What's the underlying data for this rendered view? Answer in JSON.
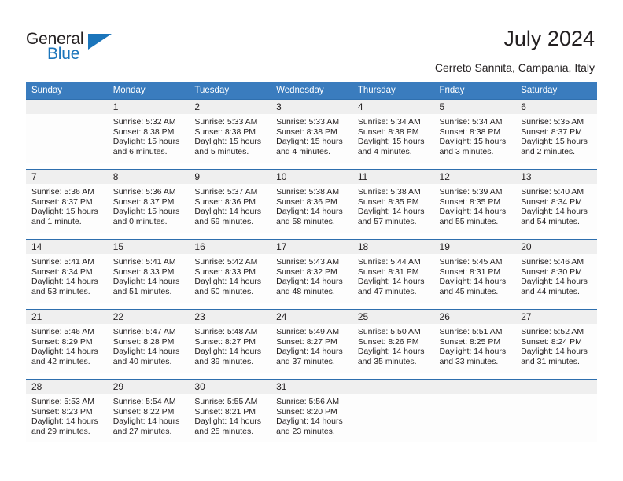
{
  "brand": {
    "name_part1": "General",
    "name_part2": "Blue",
    "triangle_icon": "triangle-icon",
    "colors": {
      "dark": "#231f20",
      "blue": "#1b75bb"
    }
  },
  "header": {
    "title": "July 2024",
    "subtitle": "Cerreto Sannita, Campania, Italy"
  },
  "calendar": {
    "header_bg": "#3a7cbe",
    "row_rule_color": "#2f6fae",
    "daynum_band_bg": "#efefef",
    "weekday_headers": [
      "Sunday",
      "Monday",
      "Tuesday",
      "Wednesday",
      "Thursday",
      "Friday",
      "Saturday"
    ],
    "weeks": [
      [
        {
          "day": "",
          "empty": true,
          "sunrise": "",
          "sunset": "",
          "daylight": ""
        },
        {
          "day": "1",
          "sunrise": "Sunrise: 5:32 AM",
          "sunset": "Sunset: 8:38 PM",
          "daylight": "Daylight: 15 hours and 6 minutes."
        },
        {
          "day": "2",
          "sunrise": "Sunrise: 5:33 AM",
          "sunset": "Sunset: 8:38 PM",
          "daylight": "Daylight: 15 hours and 5 minutes."
        },
        {
          "day": "3",
          "sunrise": "Sunrise: 5:33 AM",
          "sunset": "Sunset: 8:38 PM",
          "daylight": "Daylight: 15 hours and 4 minutes."
        },
        {
          "day": "4",
          "sunrise": "Sunrise: 5:34 AM",
          "sunset": "Sunset: 8:38 PM",
          "daylight": "Daylight: 15 hours and 4 minutes."
        },
        {
          "day": "5",
          "sunrise": "Sunrise: 5:34 AM",
          "sunset": "Sunset: 8:38 PM",
          "daylight": "Daylight: 15 hours and 3 minutes."
        },
        {
          "day": "6",
          "sunrise": "Sunrise: 5:35 AM",
          "sunset": "Sunset: 8:37 PM",
          "daylight": "Daylight: 15 hours and 2 minutes."
        }
      ],
      [
        {
          "day": "7",
          "sunrise": "Sunrise: 5:36 AM",
          "sunset": "Sunset: 8:37 PM",
          "daylight": "Daylight: 15 hours and 1 minute."
        },
        {
          "day": "8",
          "sunrise": "Sunrise: 5:36 AM",
          "sunset": "Sunset: 8:37 PM",
          "daylight": "Daylight: 15 hours and 0 minutes."
        },
        {
          "day": "9",
          "sunrise": "Sunrise: 5:37 AM",
          "sunset": "Sunset: 8:36 PM",
          "daylight": "Daylight: 14 hours and 59 minutes."
        },
        {
          "day": "10",
          "sunrise": "Sunrise: 5:38 AM",
          "sunset": "Sunset: 8:36 PM",
          "daylight": "Daylight: 14 hours and 58 minutes."
        },
        {
          "day": "11",
          "sunrise": "Sunrise: 5:38 AM",
          "sunset": "Sunset: 8:35 PM",
          "daylight": "Daylight: 14 hours and 57 minutes."
        },
        {
          "day": "12",
          "sunrise": "Sunrise: 5:39 AM",
          "sunset": "Sunset: 8:35 PM",
          "daylight": "Daylight: 14 hours and 55 minutes."
        },
        {
          "day": "13",
          "sunrise": "Sunrise: 5:40 AM",
          "sunset": "Sunset: 8:34 PM",
          "daylight": "Daylight: 14 hours and 54 minutes."
        }
      ],
      [
        {
          "day": "14",
          "sunrise": "Sunrise: 5:41 AM",
          "sunset": "Sunset: 8:34 PM",
          "daylight": "Daylight: 14 hours and 53 minutes."
        },
        {
          "day": "15",
          "sunrise": "Sunrise: 5:41 AM",
          "sunset": "Sunset: 8:33 PM",
          "daylight": "Daylight: 14 hours and 51 minutes."
        },
        {
          "day": "16",
          "sunrise": "Sunrise: 5:42 AM",
          "sunset": "Sunset: 8:33 PM",
          "daylight": "Daylight: 14 hours and 50 minutes."
        },
        {
          "day": "17",
          "sunrise": "Sunrise: 5:43 AM",
          "sunset": "Sunset: 8:32 PM",
          "daylight": "Daylight: 14 hours and 48 minutes."
        },
        {
          "day": "18",
          "sunrise": "Sunrise: 5:44 AM",
          "sunset": "Sunset: 8:31 PM",
          "daylight": "Daylight: 14 hours and 47 minutes."
        },
        {
          "day": "19",
          "sunrise": "Sunrise: 5:45 AM",
          "sunset": "Sunset: 8:31 PM",
          "daylight": "Daylight: 14 hours and 45 minutes."
        },
        {
          "day": "20",
          "sunrise": "Sunrise: 5:46 AM",
          "sunset": "Sunset: 8:30 PM",
          "daylight": "Daylight: 14 hours and 44 minutes."
        }
      ],
      [
        {
          "day": "21",
          "sunrise": "Sunrise: 5:46 AM",
          "sunset": "Sunset: 8:29 PM",
          "daylight": "Daylight: 14 hours and 42 minutes."
        },
        {
          "day": "22",
          "sunrise": "Sunrise: 5:47 AM",
          "sunset": "Sunset: 8:28 PM",
          "daylight": "Daylight: 14 hours and 40 minutes."
        },
        {
          "day": "23",
          "sunrise": "Sunrise: 5:48 AM",
          "sunset": "Sunset: 8:27 PM",
          "daylight": "Daylight: 14 hours and 39 minutes."
        },
        {
          "day": "24",
          "sunrise": "Sunrise: 5:49 AM",
          "sunset": "Sunset: 8:27 PM",
          "daylight": "Daylight: 14 hours and 37 minutes."
        },
        {
          "day": "25",
          "sunrise": "Sunrise: 5:50 AM",
          "sunset": "Sunset: 8:26 PM",
          "daylight": "Daylight: 14 hours and 35 minutes."
        },
        {
          "day": "26",
          "sunrise": "Sunrise: 5:51 AM",
          "sunset": "Sunset: 8:25 PM",
          "daylight": "Daylight: 14 hours and 33 minutes."
        },
        {
          "day": "27",
          "sunrise": "Sunrise: 5:52 AM",
          "sunset": "Sunset: 8:24 PM",
          "daylight": "Daylight: 14 hours and 31 minutes."
        }
      ],
      [
        {
          "day": "28",
          "sunrise": "Sunrise: 5:53 AM",
          "sunset": "Sunset: 8:23 PM",
          "daylight": "Daylight: 14 hours and 29 minutes."
        },
        {
          "day": "29",
          "sunrise": "Sunrise: 5:54 AM",
          "sunset": "Sunset: 8:22 PM",
          "daylight": "Daylight: 14 hours and 27 minutes."
        },
        {
          "day": "30",
          "sunrise": "Sunrise: 5:55 AM",
          "sunset": "Sunset: 8:21 PM",
          "daylight": "Daylight: 14 hours and 25 minutes."
        },
        {
          "day": "31",
          "sunrise": "Sunrise: 5:56 AM",
          "sunset": "Sunset: 8:20 PM",
          "daylight": "Daylight: 14 hours and 23 minutes."
        },
        {
          "day": "",
          "empty": true,
          "sunrise": "",
          "sunset": "",
          "daylight": ""
        },
        {
          "day": "",
          "empty": true,
          "sunrise": "",
          "sunset": "",
          "daylight": ""
        },
        {
          "day": "",
          "empty": true,
          "sunrise": "",
          "sunset": "",
          "daylight": ""
        }
      ]
    ]
  }
}
